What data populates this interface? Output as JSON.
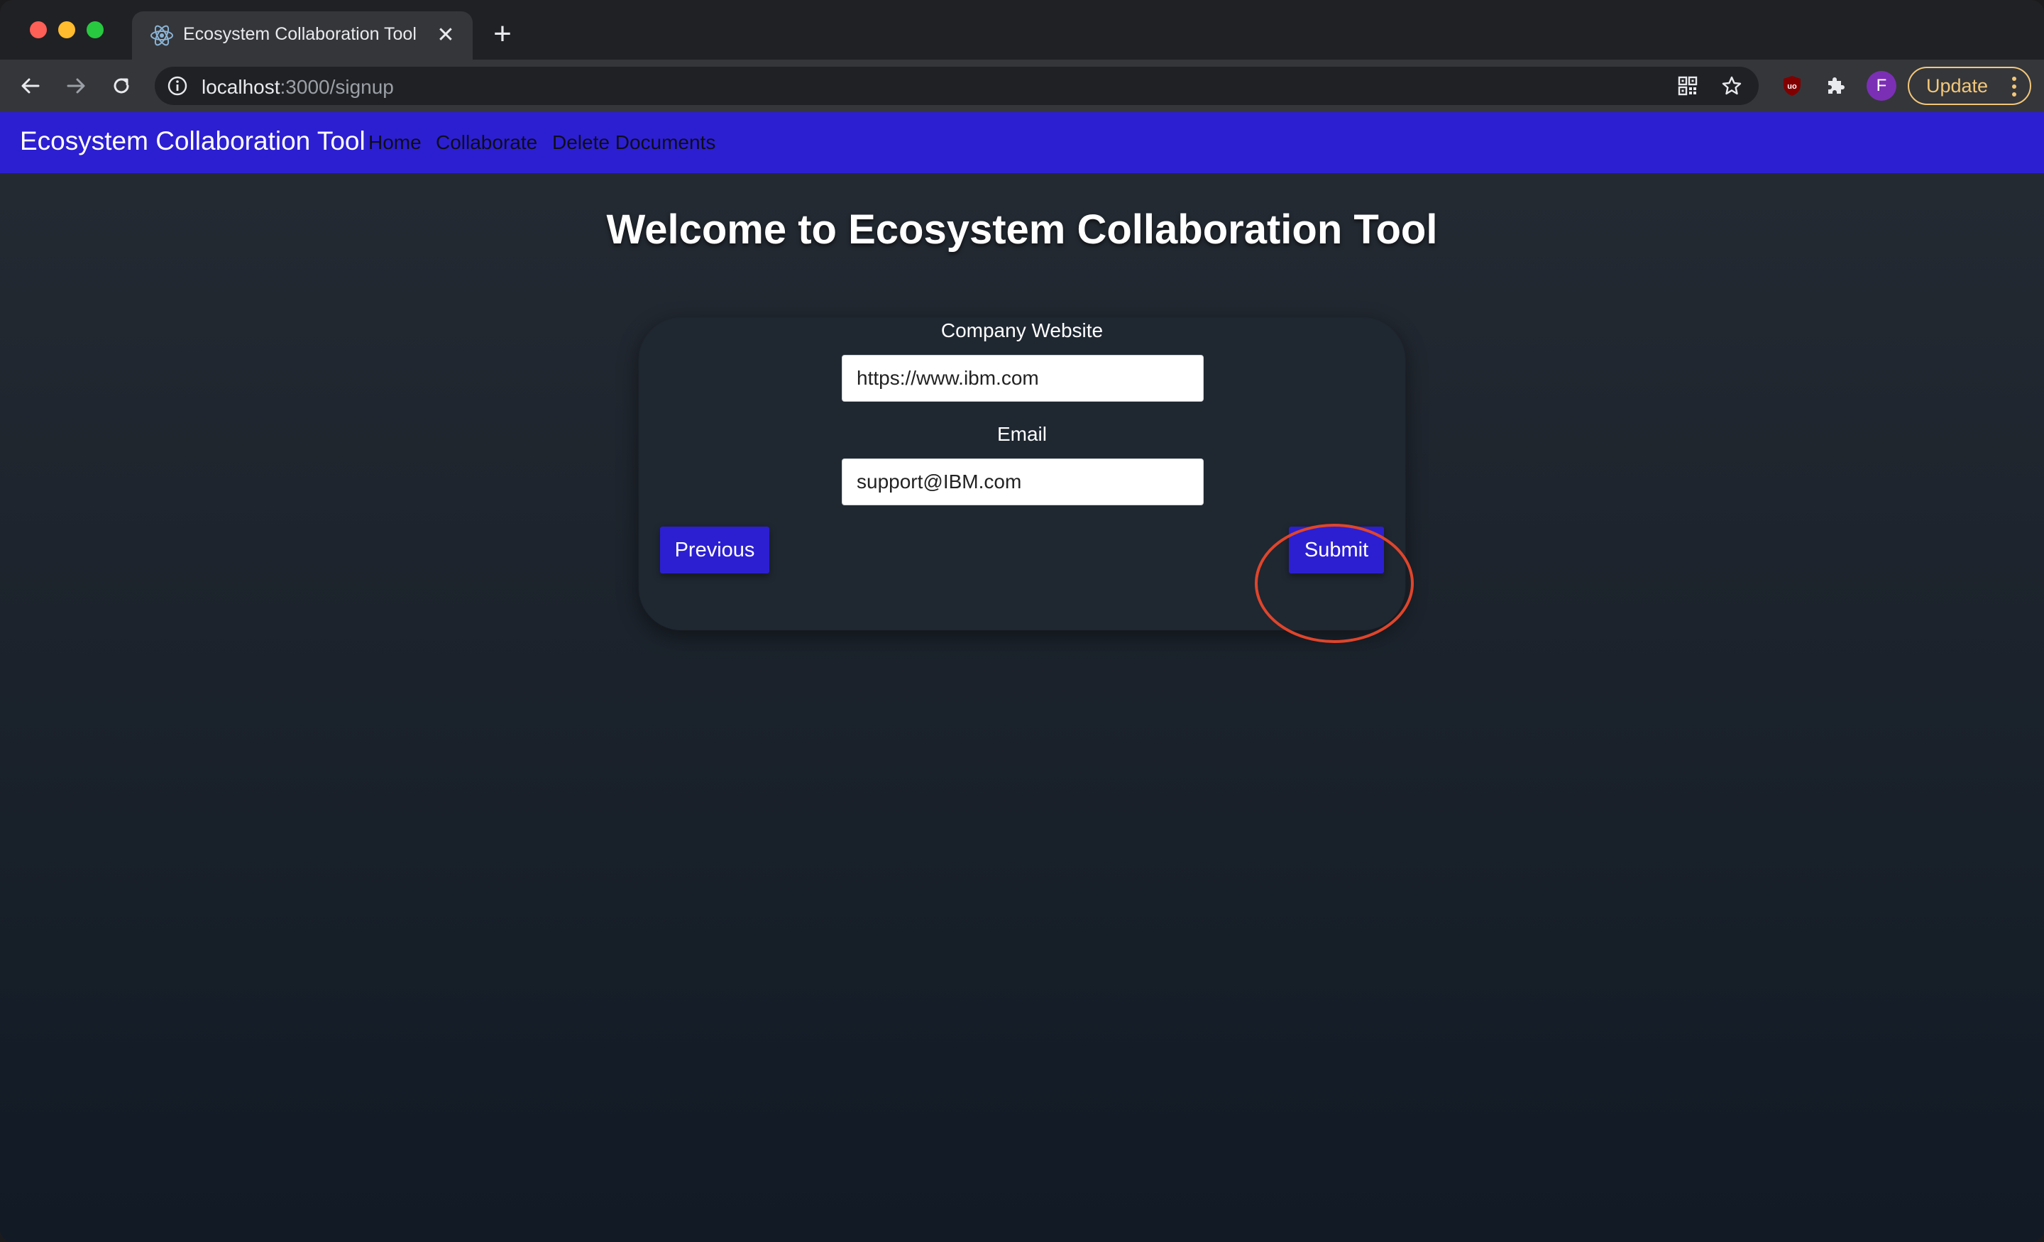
{
  "browser": {
    "tab": {
      "title": "Ecosystem Collaboration Tool",
      "favicon": "react-atom-icon"
    },
    "address_bar": {
      "host": "localhost",
      "path": ":3000/signup"
    },
    "profile_initial": "F",
    "update_label": "Update",
    "icons": [
      "back-arrow-icon",
      "forward-arrow-icon",
      "reload-icon",
      "site-info-icon",
      "qr-code-icon",
      "bookmark-star-icon",
      "ublock-icon",
      "extensions-puzzle-icon",
      "kebab-menu-icon",
      "close-icon",
      "plus-icon"
    ],
    "colors": {
      "tab_active": "#35363a",
      "toolbar": "#35363a",
      "update_accent": "#f2c77a",
      "profile": "#7b2fb5"
    }
  },
  "app": {
    "brand": "Ecosystem Collaboration Tool",
    "nav": [
      {
        "label": "Home"
      },
      {
        "label": "Collaborate"
      },
      {
        "label": "Delete Documents"
      }
    ],
    "colors": {
      "nav_bar": "#2c1fd1",
      "button": "#2c1fd1",
      "highlight": "#e0452b"
    }
  },
  "page": {
    "heading": "Welcome to Ecosystem Collaboration Tool",
    "form": {
      "website": {
        "label": "Company Website",
        "value": "https://www.ibm.com"
      },
      "email": {
        "label": "Email",
        "value": "support@IBM.com"
      },
      "previous_label": "Previous",
      "submit_label": "Submit"
    }
  }
}
